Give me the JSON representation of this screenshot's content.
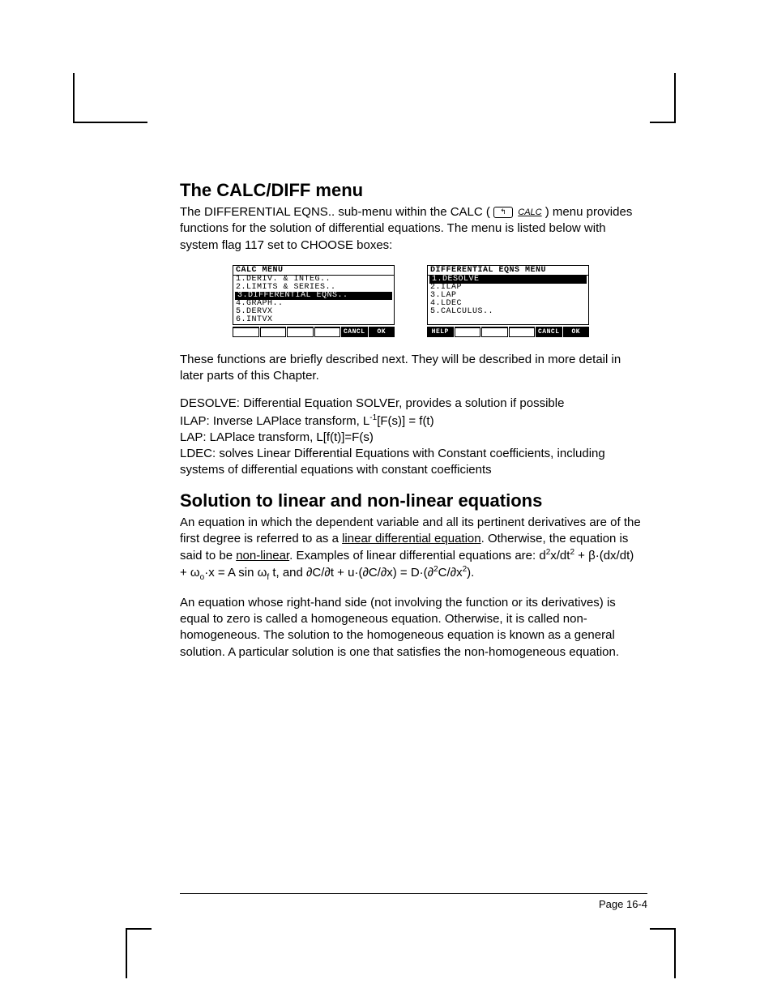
{
  "section1_title": "The CALC/DIFF menu",
  "para1_a": "The DIFFERENTIAL EQNS.. sub-menu within the CALC (",
  "para1_b": ") menu provides functions for the solution of differential equations.  The menu is listed below with system flag 117 set to CHOOSE boxes:",
  "key_shift_glyph": "↰",
  "key_label": "CALC",
  "calc_left": {
    "title": "CALC MENU",
    "items": [
      "1.DERIV. & INTEG..",
      "2.LIMITS & SERIES..",
      "3.DIFFERENTIAL EQNS..",
      "4.GRAPH..",
      "5.DERVX",
      "6.INTVX"
    ],
    "selected_index": 2,
    "soft_cancl": "CANCL",
    "soft_ok": "OK"
  },
  "calc_right": {
    "title": "DIFFERENTIAL EQNS MENU",
    "items": [
      "1.DESOLVE",
      "2.ILAP",
      "3.LAP",
      "4.LDEC",
      "5.CALCULUS.."
    ],
    "selected_index": 0,
    "soft_help": "HELP",
    "soft_cancl": "CANCL",
    "soft_ok": "OK"
  },
  "para2": "These functions are briefly described next.  They will be described in more detail in later parts of this Chapter.",
  "defs_a": "DESOLVE:  Differential Equation SOLVEr, provides a solution if possible",
  "defs_b1": "ILAP: Inverse LAPlace transform, L",
  "defs_b_sup": "-1",
  "defs_b2": "[F(s)] = f(t)",
  "defs_c": "LAP:  LAPlace transform, L[f(t)]=F(s)",
  "defs_d": "LDEC: solves Linear Differential Equations with Constant coefficients, including systems of differential equations with constant coefficients",
  "section2_title": "Solution to linear and non-linear equations",
  "para3_a": "An equation in which the dependent variable and all its pertinent derivatives are of the first degree is referred to as a ",
  "para3_u1": "linear differential equation",
  "para3_b": ".  Otherwise, the equation is said to be ",
  "para3_u2": "non-linear",
  "para3_c": ".   Examples of linear differential equations are:  d",
  "para3_sup1": "2",
  "para3_d": "x/dt",
  "para3_sup2": "2",
  "para3_e": " + β·(dx/dt) + ω",
  "para3_sub1": "o",
  "para3_f": "·x = A sin ω",
  "para3_sub2": "f",
  "para3_g": " t, and ∂C/∂t + u·(∂C/∂x) = D·(∂",
  "para3_sup3": "2",
  "para3_h": "C/∂x",
  "para3_sup4": "2",
  "para3_i": ").",
  "para4": "An equation whose right-hand side (not involving the function or its derivatives) is equal to zero is called a homogeneous equation.  Otherwise, it is called non-homogeneous.  The solution to the homogeneous equation is known as a general solution.  A particular solution is one that satisfies the non-homogeneous equation.",
  "page_number": "Page 16-4"
}
